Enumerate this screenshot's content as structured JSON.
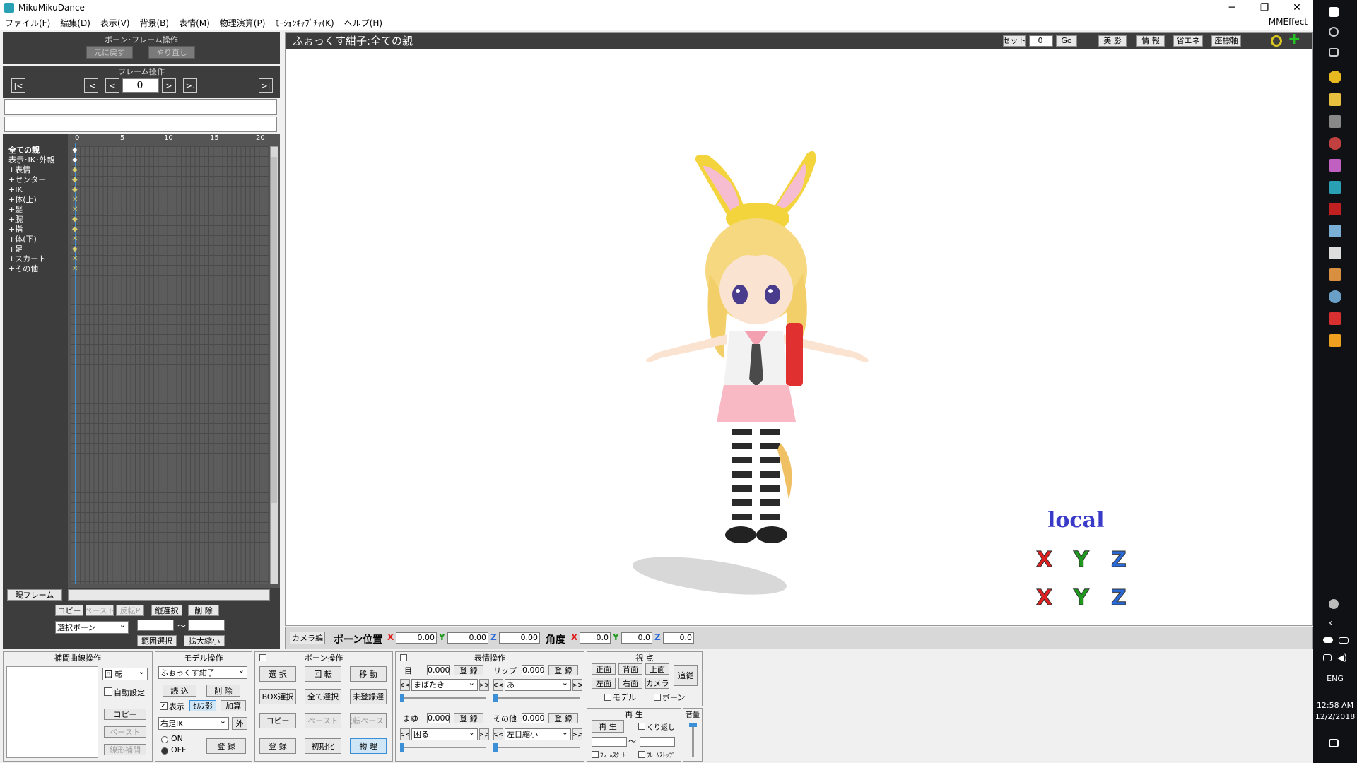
{
  "window": {
    "title": "MikuMikuDance",
    "min": "─",
    "max": "❐",
    "close": "✕"
  },
  "menu": [
    "ファイル(F)",
    "編集(D)",
    "表示(V)",
    "背景(B)",
    "表情(M)",
    "物理演算(P)",
    "ﾓｰｼｮﾝｷｬﾌﾟﾁｬ(K)",
    "ヘルプ(H)"
  ],
  "mmeffect": "MMEffect",
  "bone_frame": {
    "title": "ボーン･フレーム操作",
    "undo": "元に戻す",
    "redo": "やり直し"
  },
  "frame_ops": {
    "title": "フレーム操作",
    "first": "|<",
    "prevkey": ".<",
    "prev": "<",
    "frame": "0",
    "next": ">",
    "nextkey": ">.",
    "last": ">|"
  },
  "timeline": {
    "ticks": [
      "0",
      "5",
      "10",
      "15",
      "20"
    ],
    "tracks": [
      {
        "label": "全ての親",
        "bold": true,
        "key": "◆"
      },
      {
        "label": "表示･IK･外親",
        "bold": false,
        "key": "◆"
      },
      {
        "label": "+表情",
        "bold": false,
        "key": "◆"
      },
      {
        "label": "+センター",
        "bold": false,
        "key": "◆"
      },
      {
        "label": "+IK",
        "bold": false,
        "key": "◆"
      },
      {
        "label": "+体(上)",
        "bold": false,
        "key": "✕"
      },
      {
        "label": "+髪",
        "bold": false,
        "key": "✕"
      },
      {
        "label": "+腕",
        "bold": false,
        "key": "◆"
      },
      {
        "label": "+指",
        "bold": false,
        "key": "◆"
      },
      {
        "label": "+体(下)",
        "bold": false,
        "key": "✕"
      },
      {
        "label": "+足",
        "bold": false,
        "key": "◆"
      },
      {
        "label": "+スカート",
        "bold": false,
        "key": "✕"
      },
      {
        "label": "+その他",
        "bold": false,
        "key": "✕"
      }
    ]
  },
  "frame_bottom": {
    "current": "現フレーム",
    "copy": "コピー",
    "paste": "ペースト",
    "revpaste": "反転P",
    "vsel": "縦選択",
    "delete": "削 除",
    "selbone": "選択ボーン",
    "tilde": "～",
    "range": "範囲選択",
    "scale": "拡大縮小"
  },
  "viewport": {
    "title": "ふぉっくす紺子:全ての親",
    "set": "セット",
    "frame": "0",
    "go": "Go",
    "beauty": "美 影",
    "info": "情 報",
    "eco": "省エネ",
    "axis": "座標軸",
    "local": "local",
    "ax_x": "X",
    "ax_y": "Y",
    "ax_z": "Z"
  },
  "bone_pos": {
    "camera": "カメラ編",
    "pos": "ボーン位置",
    "x": "X",
    "xv": "0.00",
    "y": "Y",
    "yv": "0.00",
    "z": "Z",
    "zv": "0.00",
    "angle": "角度",
    "ax": "X",
    "axv": "0.0",
    "ay": "Y",
    "ayv": "0.0",
    "az": "Z",
    "azv": "0.0"
  },
  "interp": {
    "title": "補間曲線操作",
    "rot": "回 転",
    "auto": "自動設定",
    "copy": "コピー",
    "paste": "ペースト",
    "linear": "線形補間"
  },
  "model": {
    "title": "モデル操作",
    "name": "ふぉっくす紺子",
    "load": "読 込",
    "delete": "削 除",
    "show": "表示",
    "selfshadow": "ｾﾙﾌ影",
    "add": "加算",
    "bone": "右足IK",
    "outer": "外",
    "on": "ON",
    "off": "OFF",
    "register": "登 録"
  },
  "bone_ops": {
    "title": "ボーン操作",
    "select": "選 択",
    "rotate": "回 転",
    "move": "移 動",
    "box": "BOX選択",
    "all": "全て選択",
    "unreg": "未登録選",
    "copy": "コピー",
    "paste": "ペースト",
    "revpaste": "反転ペースト",
    "register": "登 録",
    "init": "初期化",
    "physics": "物 理"
  },
  "morph": {
    "title": "表情操作",
    "eye": "目",
    "eye_v": "0.000",
    "lip": "リップ",
    "lip_v": "0.000",
    "reg": "登 録",
    "eye_sel": "まばたき",
    "lip_sel": "あ",
    "brow": "まゆ",
    "brow_v": "0.000",
    "other": "その他",
    "other_v": "0.000",
    "brow_sel": "困る",
    "other_sel": "左目縮小",
    "prev": "<<",
    "next": ">>"
  },
  "view": {
    "title": "視 点",
    "front": "正面",
    "back": "背面",
    "top": "上面",
    "follow": "追従",
    "left": "左面",
    "right": "右面",
    "camera": "カメラ",
    "model": "モデル",
    "bone": "ボーン"
  },
  "play": {
    "title": "再 生",
    "play": "再 生",
    "repeat": "くり返し",
    "tilde": "～",
    "fstart": "ﾌﾚｰﾑｽﾀｰﾄ",
    "fstop": "ﾌﾚｰﾑｽﾄｯﾌﾟ",
    "volume": "音量"
  },
  "taskbar": {
    "lang": "ENG",
    "time": "12:58 AM",
    "date": "12/2/2018"
  },
  "colors": {
    "accent": "#3a8fd6",
    "x": "#e02020",
    "y": "#1f9a1f",
    "z": "#2a6ad8"
  }
}
